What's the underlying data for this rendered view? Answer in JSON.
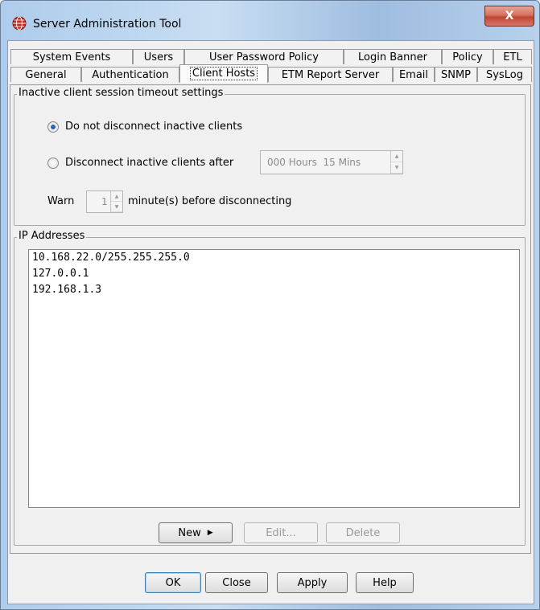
{
  "window": {
    "title": "Server Administration Tool",
    "close_label": "X",
    "icon": "globe-icon"
  },
  "tabs_row1": [
    "System Events",
    "Users",
    "User Password Policy",
    "Login Banner",
    "Policy",
    "ETL"
  ],
  "tabs_row2": [
    "General",
    "Authentication",
    "Client Hosts",
    "ETM Report Server",
    "Email",
    "SNMP",
    "SysLog"
  ],
  "active_tab": "Client Hosts",
  "timeout": {
    "legend": "Inactive client session timeout settings",
    "option_no_disconnect": "Do not disconnect inactive clients",
    "option_disconnect": "Disconnect inactive clients after",
    "selected": "Do not disconnect inactive clients",
    "duration_value": "000 Hours  15 Mins",
    "warn_label": "Warn",
    "warn_value": "1",
    "warn_suffix": "minute(s) before disconnecting"
  },
  "ip": {
    "legend": "IP Addresses",
    "addresses": [
      "10.168.22.0/255.255.255.0",
      "127.0.0.1",
      "192.168.1.3"
    ],
    "new_label": "New",
    "edit_label": "Edit...",
    "delete_label": "Delete"
  },
  "footer": {
    "ok": "OK",
    "close": "Close",
    "apply": "Apply",
    "help": "Help"
  },
  "colors": {
    "accent": "#2a62b5",
    "close_button": "#c04631"
  }
}
